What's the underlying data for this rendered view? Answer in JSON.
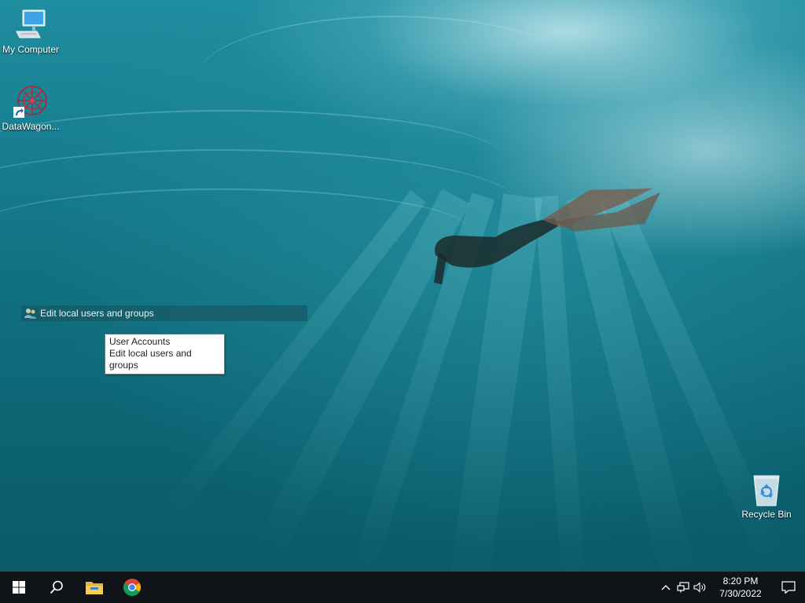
{
  "desktop": {
    "icons": [
      {
        "label": "My Computer",
        "icon": "computer-icon"
      },
      {
        "label": "DataWagon...",
        "icon": "datawagon-app-icon"
      },
      {
        "label": "Recycle Bin",
        "icon": "recycle-bin-icon"
      }
    ]
  },
  "search_result": {
    "label": "Edit local users and groups",
    "icon": "users-icon"
  },
  "tooltip": {
    "line1": "User Accounts",
    "line2": "Edit local users and groups"
  },
  "taskbar": {
    "buttons": [
      {
        "icon": "windows-start-icon"
      },
      {
        "icon": "search-icon"
      },
      {
        "icon": "file-explorer-icon"
      },
      {
        "icon": "chrome-icon"
      }
    ],
    "tray": {
      "icons": [
        "chevron-up-icon",
        "network-icon",
        "volume-icon"
      ],
      "time": "8:20 PM",
      "date": "7/30/2022",
      "notification_icon": "action-center-icon"
    }
  },
  "colors": {
    "taskbar": "#101418",
    "search_highlight": "#145a64",
    "tooltip_bg": "#ffffff"
  }
}
